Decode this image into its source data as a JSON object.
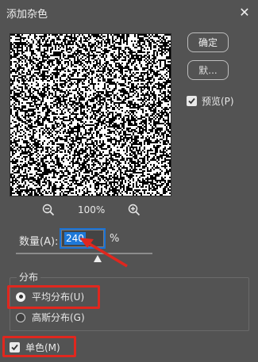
{
  "dialog": {
    "title": "添加杂色",
    "close_glyph": "✕"
  },
  "buttons": {
    "ok_label": "确定",
    "reset_label": "默..."
  },
  "preview_toggle": {
    "label": "预览(P)",
    "checked": true
  },
  "zoom": {
    "level": "100%",
    "zoom_out_icon": "zoom-out-icon",
    "zoom_in_icon": "zoom-in-icon"
  },
  "amount": {
    "label": "数量(A):",
    "value": "240",
    "unit": "%",
    "slider_fraction": 0.6
  },
  "distribution": {
    "legend": "分布",
    "options": [
      {
        "label": "平均分布(U)",
        "selected": true
      },
      {
        "label": "高斯分布(G)",
        "selected": false
      }
    ]
  },
  "monochromatic": {
    "label": "单色(M)",
    "checked": true
  },
  "colors": {
    "background": "#535353",
    "annotation_red": "#e0271e",
    "selection_blue": "#1e78d8"
  }
}
